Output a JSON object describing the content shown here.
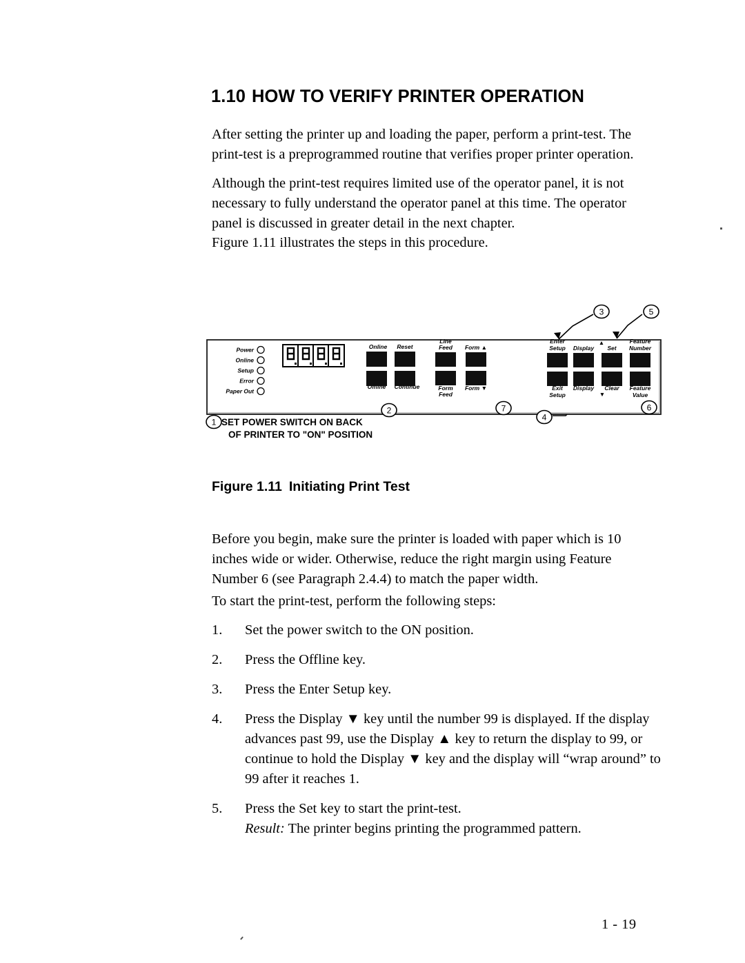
{
  "heading": {
    "number": "1.10",
    "title": "HOW TO VERIFY PRINTER OPERATION"
  },
  "paragraphs": {
    "intro_1": "After setting the printer up and loading the paper, perform a print-test. The print-test is a preprogrammed routine that verifies proper printer operation.",
    "intro_2": "Although the print-test requires limited use of the operator panel, it is not necessary to fully understand the operator panel at this time. The operator panel is discussed in greater detail in the next chapter.",
    "intro_3": "Figure 1.11 illustrates the steps in this procedure.",
    "before_begin": "Before you begin, make sure the printer is loaded with paper which is 10 inches wide or wider. Otherwise, reduce the right margin using Feature Number 6 (see Paragraph 2.4.4) to match the paper width.",
    "start_steps": "To start the print-test, perform the following steps:"
  },
  "figure": {
    "caption_label": "Figure 1.11",
    "caption_text": "Initiating Print Test",
    "panel": {
      "indicators": [
        {
          "label": "Power"
        },
        {
          "label": "Online"
        },
        {
          "label": "Setup"
        },
        {
          "label": "Error"
        },
        {
          "label": "Paper Out"
        }
      ],
      "display": {
        "name": "seven-segment-display",
        "digits": [
          "8",
          "8",
          "8",
          "8"
        ],
        "digit_count": 4
      },
      "key_groups": [
        {
          "name": "status-keys",
          "keys": [
            {
              "top_label": "Online",
              "bottom_label": "Offline"
            },
            {
              "top_label": "Reset",
              "bottom_label": "Continue"
            }
          ]
        },
        {
          "name": "paper-keys",
          "keys": [
            {
              "top_label": "Line\nFeed",
              "bottom_label": "Form\nFeed"
            },
            {
              "top_label": "Form ▲",
              "bottom_label": "Form ▼"
            }
          ]
        },
        {
          "name": "setup-keys",
          "keys": [
            {
              "top_label": "Enter\nSetup",
              "bottom_label": "Exit\nSetup"
            },
            {
              "top_label": "Display ▲",
              "bottom_label": "Display ▼"
            },
            {
              "top_label": "Set",
              "bottom_label": "Clear"
            },
            {
              "top_label": "Feature\nNumber",
              "bottom_label": "Feature\nValue"
            }
          ]
        }
      ]
    },
    "callouts": [
      {
        "number": "1",
        "text": "SET POWER SWITCH ON BACK\nOF PRINTER TO \"ON\" POSITION"
      },
      {
        "number": "2",
        "text": ""
      },
      {
        "number": "3",
        "text": ""
      },
      {
        "number": "4",
        "text": ""
      },
      {
        "number": "5",
        "text": ""
      },
      {
        "number": "6",
        "text": ""
      },
      {
        "number": "7",
        "text": ""
      }
    ],
    "callout_1_line_1": "SET POWER SWITCH ON BACK",
    "callout_1_line_2": "OF PRINTER TO \"ON\" POSITION"
  },
  "steps": [
    {
      "number": "1.",
      "text": "Set the power switch to the ON position."
    },
    {
      "number": "2.",
      "text": "Press the Offline key."
    },
    {
      "number": "3.",
      "text": "Press the Enter Setup key."
    },
    {
      "number": "4.",
      "text": "Press the Display ▼ key until the number 99 is displayed. If the display advances past 99, use the Display ▲  key to return the display to 99, or continue to hold the Display ▼ key and the display will “wrap around” to 99 after it reaches 1."
    },
    {
      "number": "5.",
      "text": "Press the Set key to start the print-test.",
      "result_label": "Result:",
      "result_text": " The printer begins printing the programmed pattern."
    }
  ],
  "footer": {
    "page_number": "1 - 19"
  },
  "colors": {
    "text": "#000000",
    "paper": "#ffffff",
    "key_fill": "#101010",
    "panel_border": "#1a1a1a"
  }
}
